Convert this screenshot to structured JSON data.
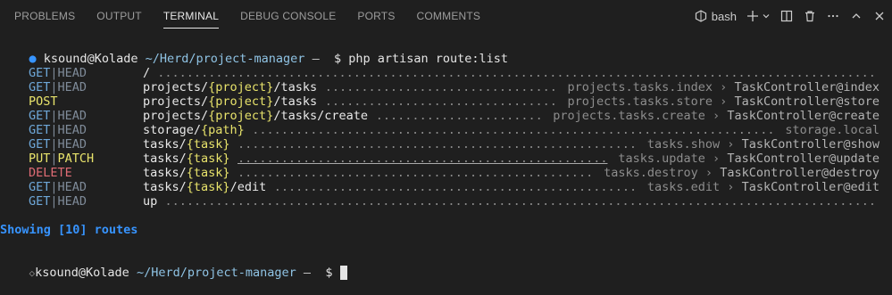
{
  "tabs": [
    "PROBLEMS",
    "OUTPUT",
    "TERMINAL",
    "DEBUG CONSOLE",
    "PORTS",
    "COMMENTS"
  ],
  "active_tab": "TERMINAL",
  "shell": {
    "name": "bash",
    "icon": "bash-terminal-icon"
  },
  "toolbar_icons": [
    "add-terminal-icon",
    "chevron-down-icon",
    "split-terminal-icon",
    "trash-icon",
    "more-icon",
    "maximize-panel-icon",
    "close-icon"
  ],
  "prompt": {
    "user": "ksound@Kolade",
    "path": "~/Herd/project-manager",
    "dash": "—",
    "symbol": "$",
    "command": "php artisan route:list"
  },
  "routes": [
    {
      "methods": [
        [
          "GET",
          "get"
        ],
        [
          "|",
          "sep"
        ],
        [
          "HEAD",
          "head"
        ]
      ],
      "uri": [
        [
          "/",
          ""
        ]
      ],
      "name": "",
      "controller": ""
    },
    {
      "methods": [
        [
          "GET",
          "get"
        ],
        [
          "|",
          "sep"
        ],
        [
          "HEAD",
          "head"
        ]
      ],
      "uri": [
        [
          "projects/",
          ""
        ],
        [
          "{project}",
          "param"
        ],
        [
          "/tasks",
          ""
        ]
      ],
      "name": "projects.tasks.index",
      "controller": "TaskController@index"
    },
    {
      "methods": [
        [
          "POST",
          "post"
        ]
      ],
      "uri": [
        [
          "projects/",
          ""
        ],
        [
          "{project}",
          "param"
        ],
        [
          "/tasks",
          ""
        ]
      ],
      "name": "projects.tasks.store",
      "controller": "TaskController@store"
    },
    {
      "methods": [
        [
          "GET",
          "get"
        ],
        [
          "|",
          "sep"
        ],
        [
          "HEAD",
          "head"
        ]
      ],
      "uri": [
        [
          "projects/",
          ""
        ],
        [
          "{project}",
          "param"
        ],
        [
          "/tasks/create",
          ""
        ]
      ],
      "name": "projects.tasks.create",
      "controller": "TaskController@create"
    },
    {
      "methods": [
        [
          "GET",
          "get"
        ],
        [
          "|",
          "sep"
        ],
        [
          "HEAD",
          "head"
        ]
      ],
      "uri": [
        [
          "storage/",
          ""
        ],
        [
          "{path}",
          "param"
        ]
      ],
      "name": "storage.local",
      "controller": ""
    },
    {
      "methods": [
        [
          "GET",
          "get"
        ],
        [
          "|",
          "sep"
        ],
        [
          "HEAD",
          "head"
        ]
      ],
      "uri": [
        [
          "tasks/",
          ""
        ],
        [
          "{task}",
          "param"
        ]
      ],
      "name": "tasks.show",
      "controller": "TaskController@show"
    },
    {
      "methods": [
        [
          "PUT",
          "put"
        ],
        [
          "|",
          "sep"
        ],
        [
          "PATCH",
          "put"
        ]
      ],
      "uri": [
        [
          "tasks/",
          ""
        ],
        [
          "{task}",
          "param"
        ]
      ],
      "name": "tasks.update",
      "controller": "TaskController@update"
    },
    {
      "methods": [
        [
          "DELETE",
          "delete"
        ]
      ],
      "uri": [
        [
          "tasks/",
          ""
        ],
        [
          "{task}",
          "param"
        ]
      ],
      "name": "tasks.destroy",
      "controller": "TaskController@destroy"
    },
    {
      "methods": [
        [
          "GET",
          "get"
        ],
        [
          "|",
          "sep"
        ],
        [
          "HEAD",
          "head"
        ]
      ],
      "uri": [
        [
          "tasks/",
          ""
        ],
        [
          "{task}",
          "param"
        ],
        [
          "/edit",
          ""
        ]
      ],
      "name": "tasks.edit",
      "controller": "TaskController@edit"
    },
    {
      "methods": [
        [
          "GET",
          "get"
        ],
        [
          "|",
          "sep"
        ],
        [
          "HEAD",
          "head"
        ]
      ],
      "uri": [
        [
          "up",
          ""
        ]
      ],
      "name": "",
      "controller": ""
    }
  ],
  "summary": "Showing [10] routes",
  "colors": {
    "accent": "#3794ff",
    "param": "#e8e36b",
    "get": "#6ea7d8",
    "delete": "#e06c75"
  }
}
